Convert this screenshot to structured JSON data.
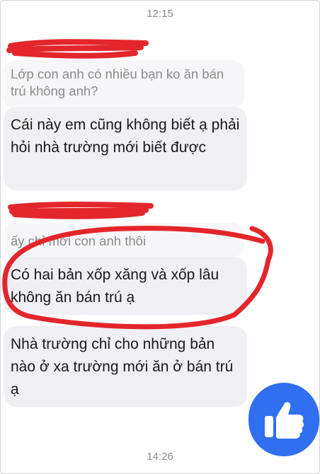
{
  "chat": {
    "top_timestamp": "12:15",
    "bottom_timestamp": "14:26",
    "messages": [
      {
        "kind": "quoted",
        "text": "Lớp con anh có nhiều bạn ko ăn bán trú không anh?"
      },
      {
        "kind": "reply",
        "text": "Cái này em cũng không biết ạ phải hỏi nhà trường mới biết được"
      },
      {
        "kind": "quoted",
        "text": "ấy chỉ mời con anh thôi"
      },
      {
        "kind": "reply",
        "text": "Có hai bản xốp xăng và xốp lâu không ăn bán trú ạ"
      },
      {
        "kind": "reply",
        "text": "Nhà trường chỉ cho những bản nào ở xa trường mới ăn ở bán trú ạ"
      }
    ]
  },
  "overlay": {
    "like_icon": "thumbs-up-icon",
    "like_color": "#2f6ff0",
    "annotation_color": "#e3262b"
  }
}
